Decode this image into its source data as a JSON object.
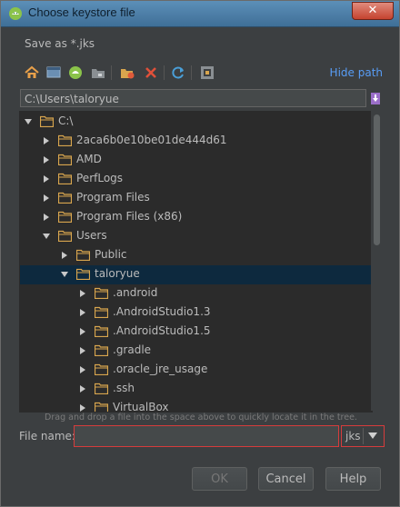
{
  "window": {
    "title": "Choose keystore file",
    "close_label": "✕"
  },
  "dialog": {
    "subtitle": "Save as *.jks"
  },
  "toolbar": {
    "icons": [
      "home-icon",
      "desktop-icon",
      "android-project-icon",
      "module-folder-icon",
      "new-folder-icon",
      "delete-icon",
      "refresh-icon",
      "show-hidden-icon"
    ],
    "hide_path_label": "Hide path"
  },
  "path": {
    "value": "C:\\Users\\taloryue"
  },
  "tree": {
    "items": [
      {
        "label": "C:\\",
        "level": 0,
        "state": "expanded",
        "selected": false
      },
      {
        "label": "2aca6b0e10be01de444d61",
        "level": 1,
        "state": "collapsed",
        "selected": false
      },
      {
        "label": "AMD",
        "level": 1,
        "state": "collapsed",
        "selected": false
      },
      {
        "label": "PerfLogs",
        "level": 1,
        "state": "collapsed",
        "selected": false
      },
      {
        "label": "Program Files",
        "level": 1,
        "state": "collapsed",
        "selected": false
      },
      {
        "label": "Program Files (x86)",
        "level": 1,
        "state": "collapsed",
        "selected": false
      },
      {
        "label": "Users",
        "level": 1,
        "state": "expanded",
        "selected": false
      },
      {
        "label": "Public",
        "level": 2,
        "state": "collapsed",
        "selected": false
      },
      {
        "label": "taloryue",
        "level": 2,
        "state": "expanded",
        "selected": true
      },
      {
        "label": ".android",
        "level": 3,
        "state": "collapsed",
        "selected": false
      },
      {
        "label": ".AndroidStudio1.3",
        "level": 3,
        "state": "collapsed",
        "selected": false
      },
      {
        "label": ".AndroidStudio1.5",
        "level": 3,
        "state": "collapsed",
        "selected": false
      },
      {
        "label": ".gradle",
        "level": 3,
        "state": "collapsed",
        "selected": false
      },
      {
        "label": ".oracle_jre_usage",
        "level": 3,
        "state": "collapsed",
        "selected": false
      },
      {
        "label": ".ssh",
        "level": 3,
        "state": "collapsed",
        "selected": false
      },
      {
        "label": "VirtualBox",
        "level": 3,
        "state": "collapsed",
        "selected": false
      }
    ]
  },
  "hint": "Drag and drop a file into the space above to quickly locate it in the tree.",
  "file_name": {
    "label": "File name:",
    "value": "",
    "placeholder": ""
  },
  "extension": {
    "selected": "jks"
  },
  "buttons": {
    "ok": "OK",
    "cancel": "Cancel",
    "help": "Help"
  },
  "colors": {
    "background": "#3c3f41",
    "tree_bg": "#2b2b2b",
    "selection": "#0d293e",
    "folder": "#d9a64e",
    "link": "#589df6",
    "error_border": "#d63c3c"
  }
}
